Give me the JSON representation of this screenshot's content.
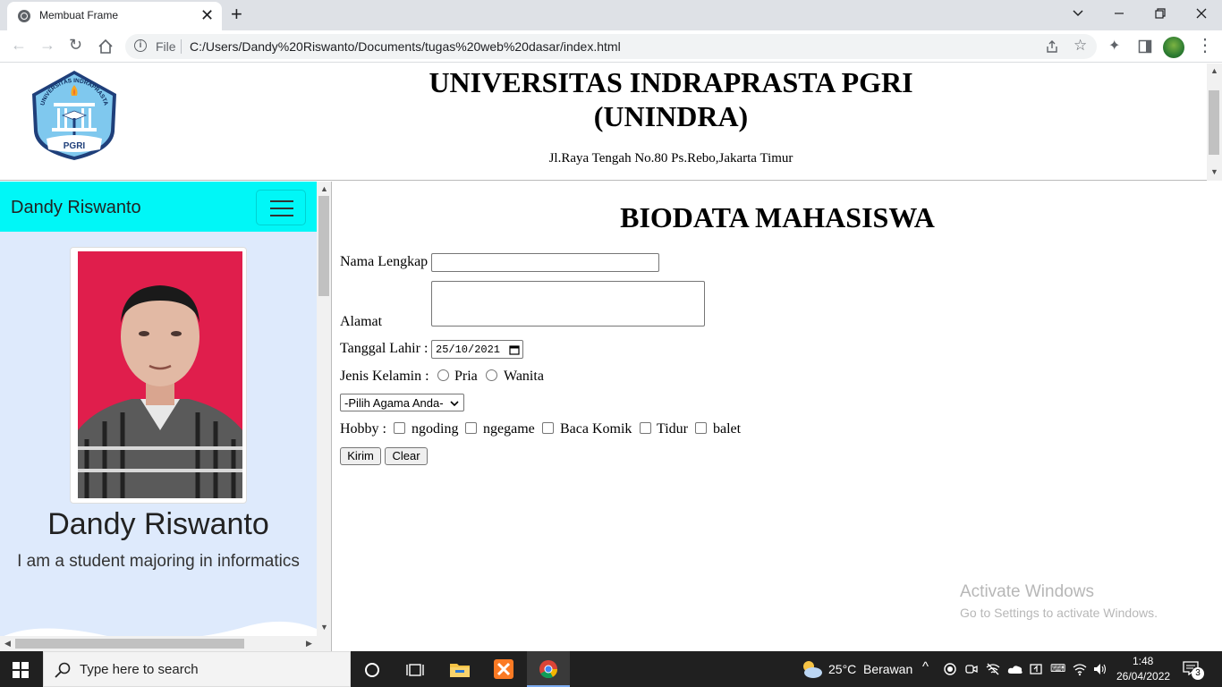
{
  "browser": {
    "tab_title": "Membuat Frame",
    "file_label": "File",
    "url": "C:/Users/Dandy%20Riswanto/Documents/tugas%20web%20dasar/index.html"
  },
  "header": {
    "title_line1": "UNIVERSITAS INDRAPRASTA PGRI",
    "title_line2": "(UNINDRA)",
    "address": "Jl.Raya Tengah No.80 Ps.Rebo,Jakarta Timur",
    "logo_arc_text": "UNIVERSITAS INDRAPRASTA",
    "logo_bottom_text": "PGRI"
  },
  "sidebar": {
    "brand": "Dandy Riswanto",
    "name": "Dandy Riswanto",
    "description": "I am a student majoring in informatics",
    "navbar_color": "#00f7f7",
    "background_color": "#deeafc"
  },
  "form": {
    "title": "BIODATA MAHASISWA",
    "nama_label": "Nama Lengkap",
    "nama_value": "",
    "alamat_label": "Alamat",
    "alamat_value": "",
    "tanggal_label": "Tanggal Lahir :",
    "tanggal_value": "25/10/2021",
    "gender_label": "Jenis Kelamin :",
    "gender_options": [
      "Pria",
      "Wanita"
    ],
    "agama_select": "-Pilih Agama Anda-",
    "hobby_label": "Hobby :",
    "hobbies": [
      "ngoding",
      "ngegame",
      "Baca Komik",
      "Tidur",
      "balet"
    ],
    "submit_label": "Kirim",
    "clear_label": "Clear"
  },
  "watermark": {
    "line1": "Activate Windows",
    "line2": "Go to Settings to activate Windows."
  },
  "taskbar": {
    "search_placeholder": "Type here to search",
    "weather_temp": "25°C",
    "weather_desc": "Berawan",
    "time": "1:48",
    "date": "26/04/2022",
    "notification_count": "3"
  }
}
